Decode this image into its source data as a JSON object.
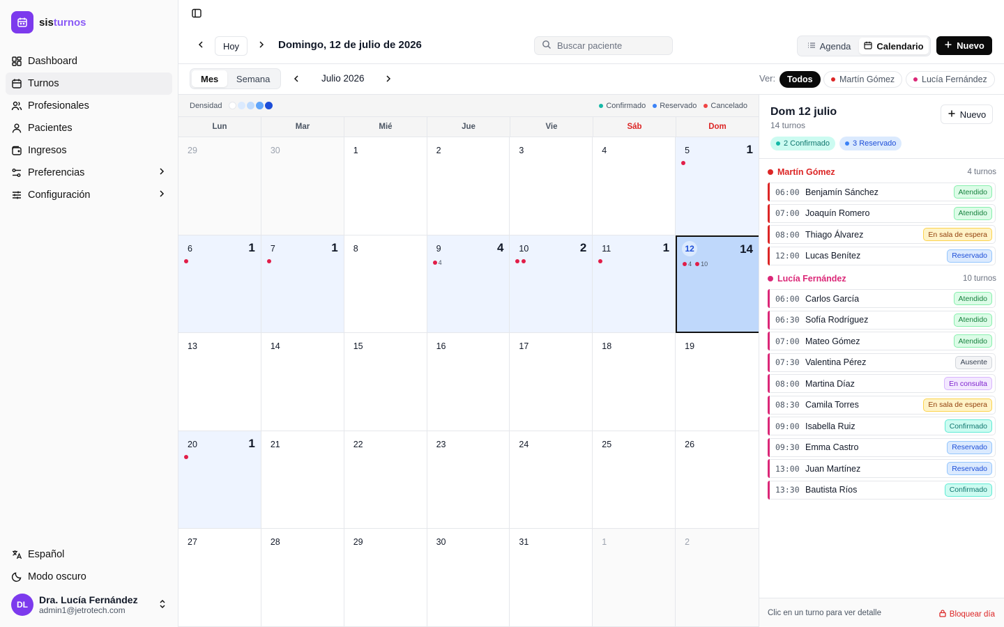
{
  "app": {
    "brand_a": "sis",
    "brand_b": "turnos"
  },
  "sidebar": {
    "items": [
      {
        "label": "Dashboard"
      },
      {
        "label": "Turnos"
      },
      {
        "label": "Profesionales"
      },
      {
        "label": "Pacientes"
      },
      {
        "label": "Ingresos"
      },
      {
        "label": "Preferencias"
      },
      {
        "label": "Configuración"
      }
    ],
    "language": "Español",
    "dark_mode": "Modo oscuro",
    "user": {
      "initials": "DL",
      "name": "Dra. Lucía Fernández",
      "email": "admin1@jetrotech.com"
    }
  },
  "header": {
    "today": "Hoy",
    "date_title": "Domingo, 12 de julio de 2026",
    "search_placeholder": "Buscar paciente",
    "view_agenda": "Agenda",
    "view_calendar": "Calendario",
    "new": "Nuevo"
  },
  "toolbar": {
    "mes": "Mes",
    "semana": "Semana",
    "month_title": "Julio 2026",
    "ver": "Ver:",
    "filters": [
      "Todos",
      "Martín Gómez",
      "Lucía Fernández"
    ]
  },
  "calendar": {
    "density_label": "Densidad",
    "legend": [
      "Confirmado",
      "Reservado",
      "Cancelado"
    ],
    "weekdays": [
      "Lun",
      "Mar",
      "Mié",
      "Jue",
      "Vie",
      "Sáb",
      "Dom"
    ],
    "days": [
      {
        "n": "29",
        "out": true
      },
      {
        "n": "30",
        "out": true
      },
      {
        "n": "1"
      },
      {
        "n": "2"
      },
      {
        "n": "3"
      },
      {
        "n": "4"
      },
      {
        "n": "5",
        "count": "1",
        "dots": [
          "#e11d48"
        ]
      },
      {
        "n": "6",
        "count": "1",
        "dots": [
          "#e11d48"
        ]
      },
      {
        "n": "7",
        "count": "1",
        "dots": [
          "#e11d48"
        ]
      },
      {
        "n": "8"
      },
      {
        "n": "9",
        "count": "4",
        "dots": [
          "#e11d48"
        ],
        "dotlabel": "4"
      },
      {
        "n": "10",
        "count": "2",
        "dots": [
          "#e11d48",
          "#e11d48"
        ]
      },
      {
        "n": "11",
        "count": "1",
        "dots": [
          "#e11d48"
        ]
      },
      {
        "n": "12",
        "count": "14",
        "sel": true,
        "dots": [
          "#e11d48"
        ],
        "dotlabel": "4",
        "dots2": [
          "#e11d48"
        ],
        "dotlabel2": "10"
      },
      {
        "n": "13"
      },
      {
        "n": "14"
      },
      {
        "n": "15"
      },
      {
        "n": "16"
      },
      {
        "n": "17"
      },
      {
        "n": "18"
      },
      {
        "n": "19"
      },
      {
        "n": "20",
        "count": "1",
        "dots": [
          "#e11d48"
        ]
      },
      {
        "n": "21"
      },
      {
        "n": "22"
      },
      {
        "n": "23"
      },
      {
        "n": "24"
      },
      {
        "n": "25"
      },
      {
        "n": "26"
      },
      {
        "n": "27"
      },
      {
        "n": "28"
      },
      {
        "n": "29"
      },
      {
        "n": "30"
      },
      {
        "n": "31"
      },
      {
        "n": "1",
        "out": true
      },
      {
        "n": "2",
        "out": true
      }
    ]
  },
  "panel": {
    "title": "Dom 12 julio",
    "subtitle": "14 turnos",
    "new": "Nuevo",
    "badge_confirmed": "2 Confirmado",
    "badge_reserved": "3 Reservado",
    "groups": [
      {
        "name": "Martín Gómez",
        "count": "4 turnos",
        "color": "#dc2626",
        "appts": [
          {
            "t": "06:00",
            "n": "Benjamín Sánchez",
            "s": "Atendido"
          },
          {
            "t": "07:00",
            "n": "Joaquín Romero",
            "s": "Atendido"
          },
          {
            "t": "08:00",
            "n": "Thiago Álvarez",
            "s": "En sala de espera"
          },
          {
            "t": "12:00",
            "n": "Lucas Benítez",
            "s": "Reservado"
          }
        ]
      },
      {
        "name": "Lucía Fernández",
        "count": "10 turnos",
        "color": "#db2777",
        "appts": [
          {
            "t": "06:00",
            "n": "Carlos García",
            "s": "Atendido"
          },
          {
            "t": "06:30",
            "n": "Sofía Rodríguez",
            "s": "Atendido"
          },
          {
            "t": "07:00",
            "n": "Mateo Gómez",
            "s": "Atendido"
          },
          {
            "t": "07:30",
            "n": "Valentina Pérez",
            "s": "Ausente"
          },
          {
            "t": "08:00",
            "n": "Martina Díaz",
            "s": "En consulta"
          },
          {
            "t": "08:30",
            "n": "Camila Torres",
            "s": "En sala de espera"
          },
          {
            "t": "09:00",
            "n": "Isabella Ruiz",
            "s": "Confirmado"
          },
          {
            "t": "09:30",
            "n": "Emma Castro",
            "s": "Reservado"
          },
          {
            "t": "13:00",
            "n": "Juan Martínez",
            "s": "Reservado"
          },
          {
            "t": "13:30",
            "n": "Bautista Ríos",
            "s": "Confirmado"
          }
        ]
      }
    ],
    "footer_hint": "Clic en un turno para ver detalle",
    "block_day": "Bloquear día"
  },
  "colors": {
    "accent": "#7c3aed",
    "confirmed": "#14b8a6",
    "reserved": "#3b82f6",
    "cancelled": "#ef4444"
  }
}
